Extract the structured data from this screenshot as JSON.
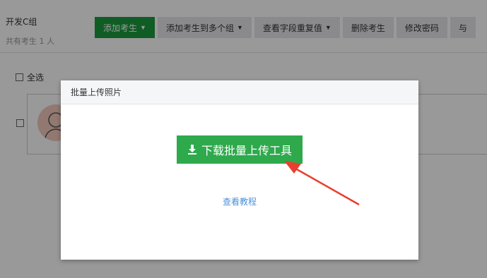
{
  "group": {
    "title": "开发C组",
    "count_text": "共有考生 1 人"
  },
  "toolbar": {
    "add_examinee": "添加考生",
    "add_to_groups": "添加考生到多个组",
    "view_duplicates": "查看字段重复值",
    "delete_examinee": "删除考生",
    "change_password": "修改密码",
    "more_partial": "与"
  },
  "list": {
    "select_all": "全选"
  },
  "modal": {
    "title": "批量上传照片",
    "download_button": "下载批量上传工具",
    "tutorial_link": "查看教程"
  },
  "colors": {
    "primary_green": "#199b3c",
    "download_green": "#2ea94c",
    "link_blue": "#4a90d9",
    "arrow_red": "#e8402f"
  }
}
